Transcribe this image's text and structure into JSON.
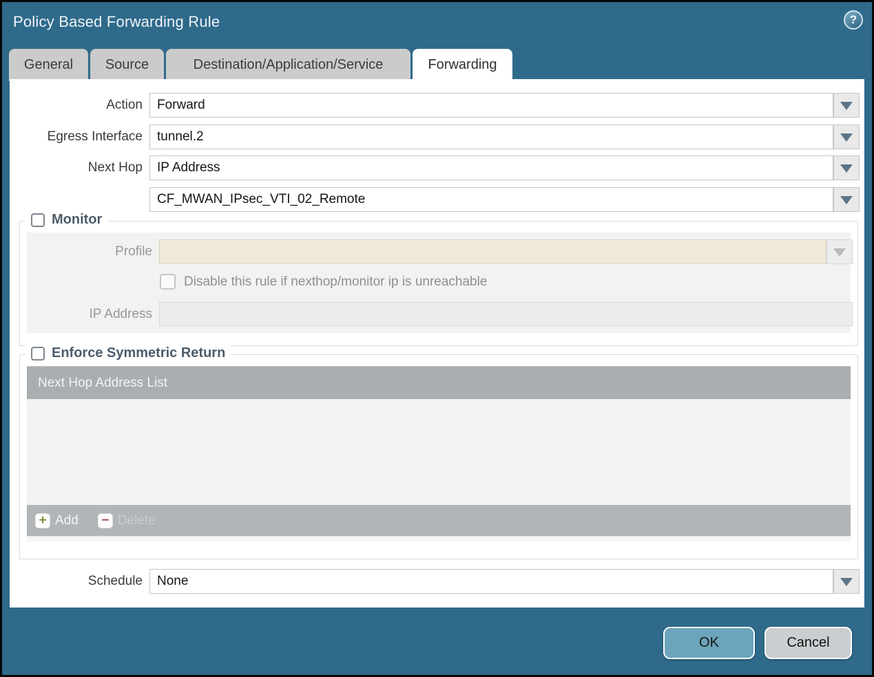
{
  "window": {
    "title": "Policy Based Forwarding Rule",
    "help_glyph": "?"
  },
  "tabs": [
    {
      "label": "General",
      "active": false
    },
    {
      "label": "Source",
      "active": false
    },
    {
      "label": "Destination/Application/Service",
      "active": false
    },
    {
      "label": "Forwarding",
      "active": true
    }
  ],
  "form": {
    "action": {
      "label": "Action",
      "value": "Forward"
    },
    "egress_interface": {
      "label": "Egress Interface",
      "value": "tunnel.2"
    },
    "next_hop": {
      "label": "Next Hop",
      "value": "IP Address"
    },
    "next_hop_address": {
      "value": "CF_MWAN_IPsec_VTI_02_Remote"
    },
    "schedule": {
      "label": "Schedule",
      "value": "None"
    }
  },
  "monitor": {
    "legend": "Monitor",
    "checked": false,
    "profile": {
      "label": "Profile",
      "value": ""
    },
    "disable_rule_checkbox": {
      "label": "Disable this rule if nexthop/monitor ip is unreachable",
      "checked": false
    },
    "ip_address": {
      "label": "IP Address",
      "value": ""
    }
  },
  "enforce": {
    "legend": "Enforce Symmetric Return",
    "checked": false,
    "table": {
      "header": "Next Hop Address List",
      "rows": []
    },
    "add_label": "Add",
    "delete_label": "Delete",
    "delete_enabled": false
  },
  "footer": {
    "ok_label": "OK",
    "cancel_label": "Cancel"
  },
  "colors": {
    "titlebar_teal": "#2f6a8b",
    "tab_inactive": "#cbcbcb",
    "legend_text": "#4d5c6b",
    "disabled_field_beige": "#f0ebd9",
    "disabled_field_gray": "#ececec",
    "table_header_gray": "#a9aeb1",
    "table_footer_gray": "#b1b5b8",
    "ok_button": "#6ba4bb",
    "cancel_button": "#caced0",
    "add_plus_green": "#7f9030",
    "delete_minus_red": "#a05252"
  }
}
